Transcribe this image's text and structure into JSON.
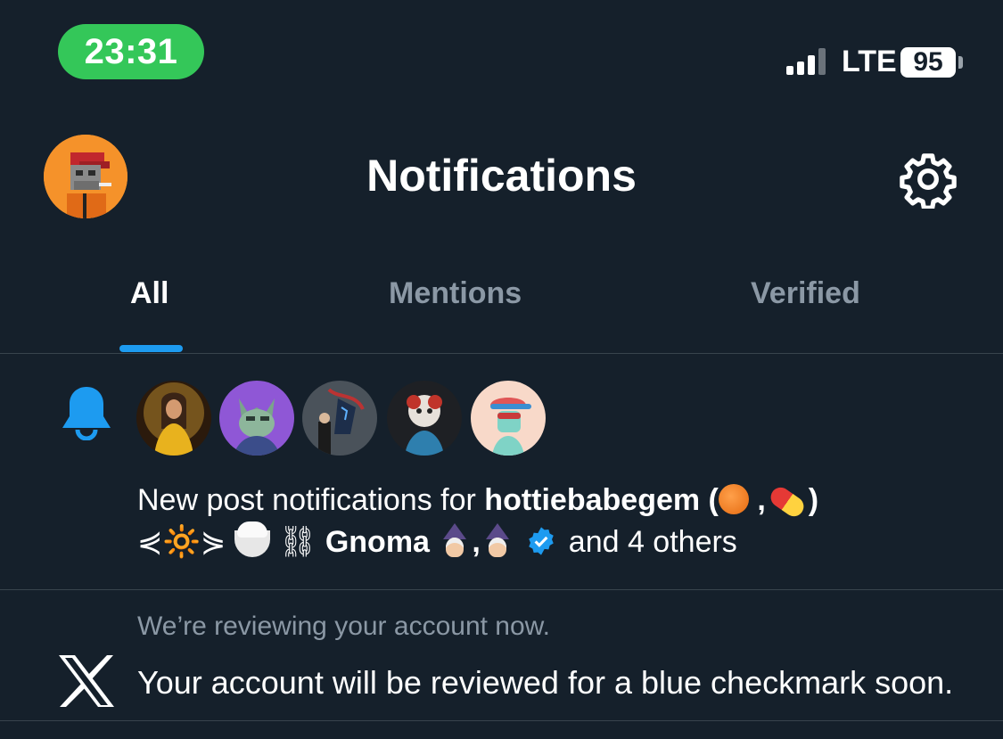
{
  "status_bar": {
    "time": "23:31",
    "network": "LTE",
    "battery": "95",
    "time_pill_color": "#34C759"
  },
  "header": {
    "title": "Notifications",
    "avatar_icon": "ape-avatar",
    "settings_icon": "gear-icon"
  },
  "tabs": [
    {
      "label": "All",
      "active": true
    },
    {
      "label": "Mentions",
      "active": false
    },
    {
      "label": "Verified",
      "active": false
    }
  ],
  "colors": {
    "background": "#15202B",
    "accent": "#1D9BF0",
    "muted_text": "#8B98A5",
    "divider": "#38444D"
  },
  "notifications": [
    {
      "type": "new-post",
      "icon": "bell-icon",
      "avatars": [
        "avatar-1",
        "avatar-2",
        "avatar-3",
        "avatar-4",
        "avatar-5"
      ],
      "prefix": "New post notifications for",
      "user1_name": "hottiebabegem (",
      "user1_close": ")",
      "sun_text": "⋞🔆⋟",
      "chain_text": "⛓",
      "user2_name": "Gnoma",
      "sep": ",",
      "suffix": "and 4 others"
    },
    {
      "type": "account-review",
      "icon": "x-logo-icon",
      "subtitle": "We’re reviewing your account now.",
      "text": "Your account will be reviewed for a blue checkmark soon."
    }
  ]
}
